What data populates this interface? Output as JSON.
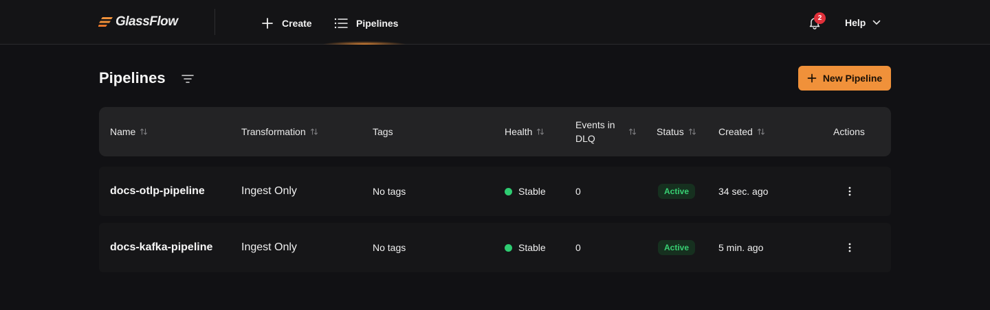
{
  "brand": {
    "name": "GlassFlow",
    "accent": "#f0913a"
  },
  "nav": {
    "create_label": "Create",
    "pipelines_label": "Pipelines",
    "active": "Pipelines"
  },
  "notifications": {
    "count": "2"
  },
  "help": {
    "label": "Help"
  },
  "page": {
    "title": "Pipelines",
    "new_button_label": "New Pipeline"
  },
  "table": {
    "headers": {
      "name": "Name",
      "transformation": "Transformation",
      "tags": "Tags",
      "health": "Health",
      "events_line1": "Events in",
      "events_line2": "DLQ",
      "status": "Status",
      "created": "Created",
      "actions": "Actions"
    },
    "rows": [
      {
        "name": "docs-otlp-pipeline",
        "transformation": "Ingest Only",
        "tags": "No tags",
        "health": "Stable",
        "dlq": "0",
        "status": "Active",
        "created": "34 sec. ago"
      },
      {
        "name": "docs-kafka-pipeline",
        "transformation": "Ingest Only",
        "tags": "No tags",
        "health": "Stable",
        "dlq": "0",
        "status": "Active",
        "created": "5 min. ago"
      }
    ]
  },
  "colors": {
    "health_stable": "#2ecc71",
    "status_active": "#38d073",
    "badge": "#e0303a"
  }
}
